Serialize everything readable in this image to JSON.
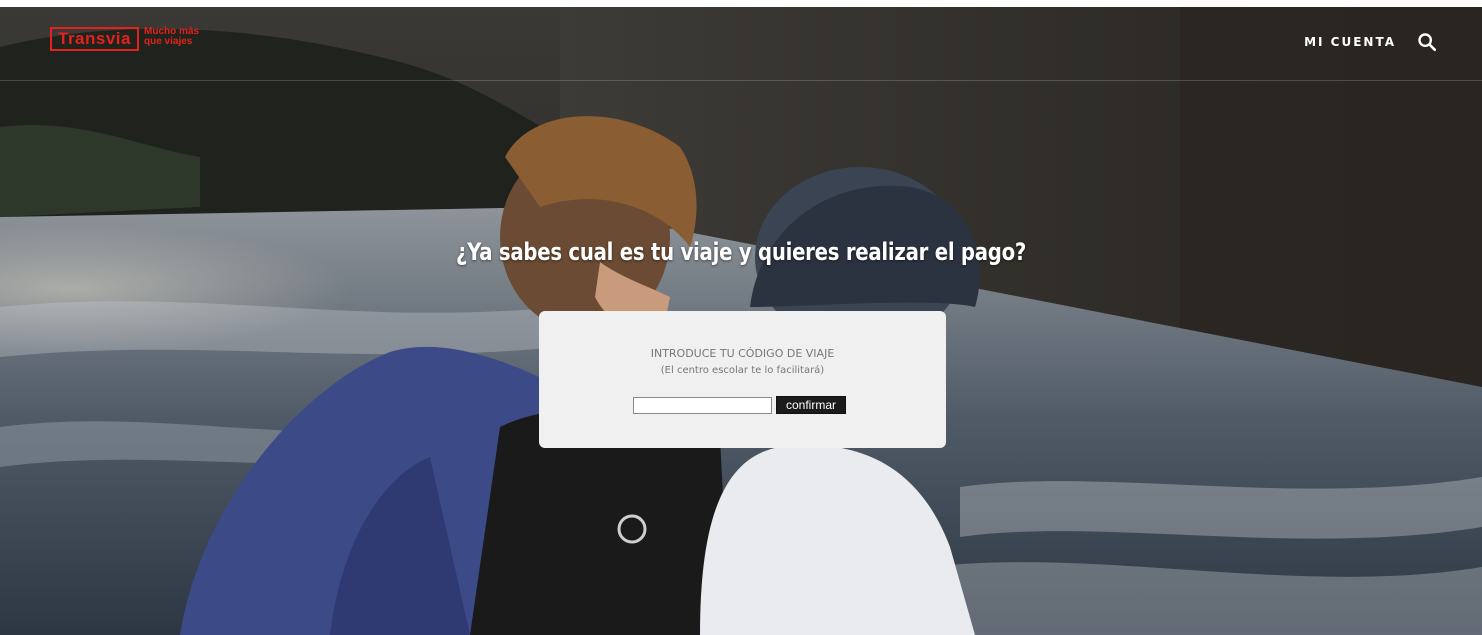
{
  "header": {
    "logo_name": "Transvia",
    "logo_tagline": "Mucho más que viajes",
    "account_label": "MI CUENTA",
    "search_icon": "search-icon"
  },
  "hero": {
    "headline": "¿Ya sabes cual es tu viaje y quieres realizar el pago?"
  },
  "card": {
    "title": "INTRODUCE TU CÓDIGO DE VIAJE",
    "subtitle": "(El centro escolar te lo facilitará)",
    "input_value": "",
    "confirm_label": "confirmar"
  },
  "colors": {
    "brand": "#e3221b",
    "card_bg": "#f0f0f0",
    "button_bg": "#1b1b1b"
  }
}
